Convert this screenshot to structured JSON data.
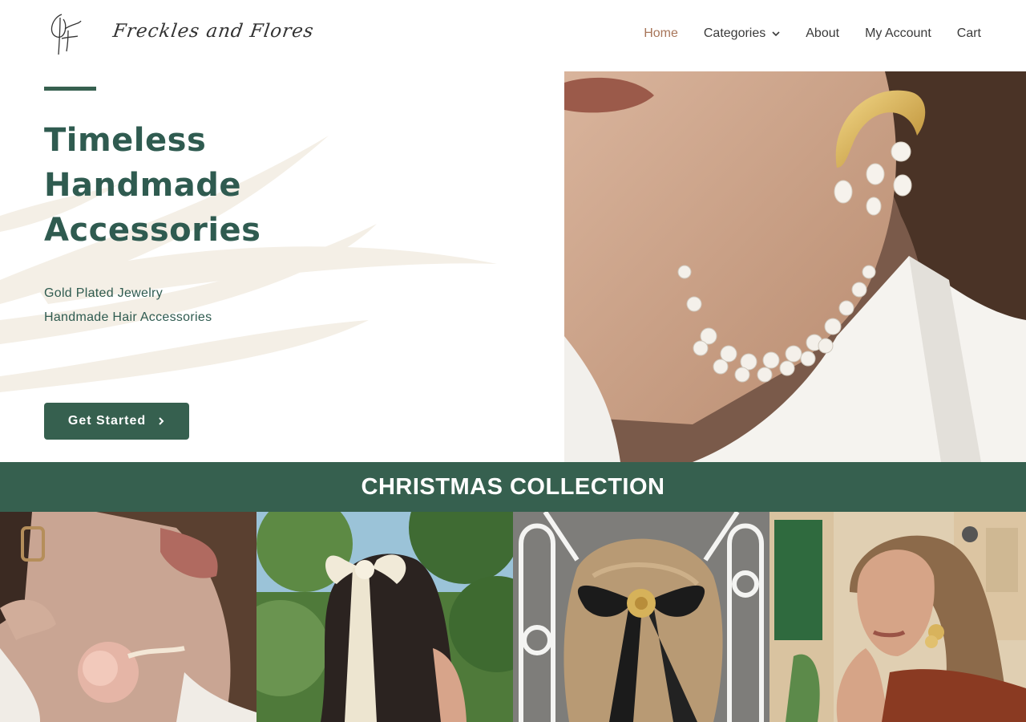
{
  "brand": {
    "logo_mark": "Ff",
    "name": "Freckles and Flores"
  },
  "nav": {
    "items": [
      {
        "label": "Home",
        "active": true
      },
      {
        "label": "Categories",
        "has_dropdown": true,
        "icon": "chevron-down-icon"
      },
      {
        "label": "About"
      },
      {
        "label": "My Account"
      },
      {
        "label": "Cart"
      }
    ]
  },
  "hero": {
    "title_lines": [
      "Timeless",
      "Handmade",
      "Accessories"
    ],
    "subtitle_lines": [
      "Gold Plated Jewelry",
      "Handmade Hair Accessories"
    ],
    "cta_label": "Get Started",
    "cta_icon": "chevron-right-icon"
  },
  "collection": {
    "title": "CHRISTMAS COLLECTION"
  },
  "colors": {
    "primary_green": "#36604f",
    "heading_green": "#2f5b50",
    "nav_active": "#a8765a",
    "nav_text": "#3a3a3a",
    "leaf_bg": "#f4efe6"
  }
}
